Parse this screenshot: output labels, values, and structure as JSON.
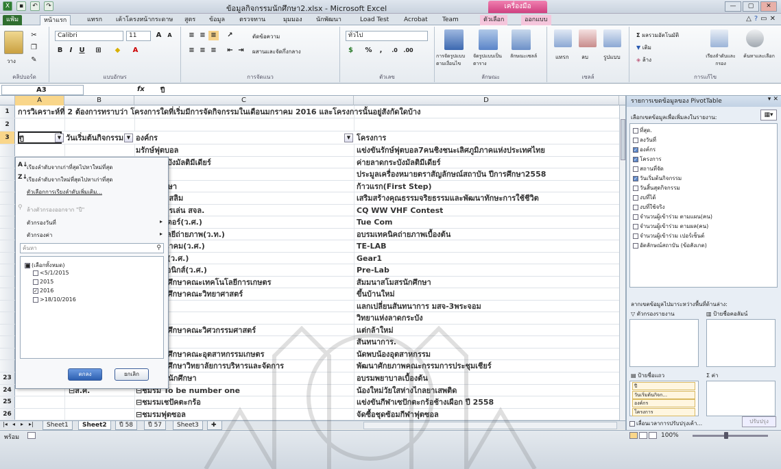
{
  "title": {
    "window": "ข้อมูลกิจกรรมนักศึกษา2.xlsx - Microsoft Excel",
    "context_tab": "เครื่องมือ PivotTable",
    "min": "—",
    "max": "▢",
    "close": "✕"
  },
  "tabs": [
    "แฟ้ม",
    "หน้าแรก",
    "แทรก",
    "เค้าโครงหน้ากระดาษ",
    "สูตร",
    "ข้อมูล",
    "ตรวจทาน",
    "มุมมอง",
    "นักพัฒนา",
    "Load Test",
    "Acrobat",
    "Team",
    "ตัวเลือก",
    "ออกแบบ"
  ],
  "ribbon": {
    "clipboard": {
      "paste": "วาง",
      "label": "คลิปบอร์ด"
    },
    "font": {
      "name": "Calibri",
      "size": "11",
      "label": "แบบอักษร"
    },
    "alignment": {
      "wrap": "ตัดข้อความ",
      "merge": "ผสานและจัดกึ่งกลาง",
      "label": "การจัดแนว"
    },
    "number": {
      "format": "ทั่วไป",
      "pct": "%",
      "comma": ",",
      "label": "ตัวเลข"
    },
    "styles": {
      "cond": "การจัดรูปแบบตามเงื่อนไข",
      "table": "จัดรูปแบบเป็นตาราง",
      "cell": "ลักษณะเซลล์",
      "label": "ลักษณะ"
    },
    "cells": {
      "insert": "แทรก",
      "delete": "ลบ",
      "format": "รูปแบบ",
      "label": "เซลล์"
    },
    "editing": {
      "sum": "ผลรวมอัตโนมัติ",
      "fill": "เติม",
      "clear": "ล้าง",
      "sort": "เรียงลำดับและกรอง",
      "find": "ค้นหาและเลือก",
      "label": "การแก้ไข"
    }
  },
  "formula": {
    "namebox": "A3",
    "fx": "fx",
    "content": "ปี"
  },
  "columns": [
    "A",
    "B",
    "C",
    "D"
  ],
  "rows": [
    {
      "n": "1",
      "a": "การวิเคราะห์ที่ 2 ต้องการทราบว่า  โครงการใดที่เริ่มมีการจัดกิจกรรมในเดือนมกราคม  2016 และโครงการนั้นอยู่สังกัดใดบ้าง",
      "c": "",
      "d": ""
    },
    {
      "n": "2",
      "a": "",
      "c": "",
      "d": ""
    },
    {
      "n": "3",
      "a": "ปี",
      "b": "วันเริ่มต้นกิจกรรม",
      "c": "องค์กร",
      "d": "โครงการ"
    }
  ],
  "body_rows": [
    {
      "c": "มรักษ์ฟุตบอล",
      "d": "แข่งขันรักษ์ฟุตบอล7คนชิงชนะเลิศภูมิภาคแห่งประเทศไทย"
    },
    {
      "c": "มลาดกระบังมัลติมีเดียร์",
      "d": "ค่ายลาดกระบังมัลติมีเดียร์"
    },
    {
      "c": "นักศึกษา",
      "d": "ประมูลเครื่องหมายตราสัญลักษณ์สถาบัน  ปีการศึกษา2558"
    },
    {
      "c": "การนักศึกษา",
      "d": "ก้าวแรก(First Step)"
    },
    {
      "c": "นักศึกษามุสลิม",
      "d": "เสริมสร้างคุณธรรมจริยธรรมและพัฒนาทักษะการใช้ชีวิต"
    },
    {
      "c": "มวิทยุสมัครเล่น  สจล.",
      "d": "CQ WW VHF Contest"
    },
    {
      "c": "มคอมพิวเตอร์(ว.ศ.)",
      "d": "Tue Com"
    },
    {
      "c": "มเทคโนโลยีถ่ายภาพ(ว.ท.)",
      "d": "อบรมเทคนิคถ่ายภาพเบื้องต้น"
    },
    {
      "c": "มโทรคมนาคม(ว.ศ.)",
      "d": "TE-LAB"
    },
    {
      "c": "มวิชาการ(ว.ศ.)",
      "d": "Gear1"
    },
    {
      "c": "มอิเลคทรอนิกส์(ว.ศ.)",
      "d": "Pre-Lab"
    },
    {
      "c": "สโมสรนักศึกษาคณะเทคโนโลยีการเกษตร",
      "d": "สัมมนาสโมสรนักศึกษา"
    },
    {
      "c": "สโมสรนักศึกษาคณะวิทยาศาสตร์",
      "d": "ขึ้นบ้านใหม่"
    },
    {
      "c": "",
      "d": "แลกเปลี่ยนสันทนาการ  มสจ-3พระจอม"
    },
    {
      "c": "",
      "d": "วิทยาแห่งลาดกระบัง"
    },
    {
      "c": "สโมสรนักศึกษาคณะวิศวกรรมศาสตร์",
      "d": "แต่กล้าใหม่"
    },
    {
      "c": "",
      "d": "สันทนาการ."
    },
    {
      "c": "สโมสรนักศึกษาคณะอุตสาหกรรมเกษตร",
      "d": "นัดพบน้องอุตสาหกรรม"
    },
    {
      "c": "สโมสรนักศึกษาวิทยาลัยการบริหารและจัดการ",
      "d": "พัฒนาศักยภาพคณะกรรมการประชุมเชียร์"
    }
  ],
  "tail_rows": [
    {
      "n": "23",
      "b": "",
      "c": "⊟องค์การนักศึกษา",
      "d": "อบรมพยาบาลเบื้องต้น"
    },
    {
      "n": "24",
      "b": "⊟ส.ศ.",
      "c": "⊟ชมรม  To be number one",
      "d": "น้องใหม่วัยใสห่างไกลยาเสพติด"
    },
    {
      "n": "25",
      "b": "",
      "c": "⊟ชมรมเชปัคตะกร้อ",
      "d": "แข่งขันกีฬาเซปักตะกร้อช้างเผือก  ปี  2558"
    },
    {
      "n": "26",
      "b": "",
      "c": "⊟ชมรมฟุตซอล",
      "d": "จัดซื้อชุดซ้อมกีฬาฟุตซอล"
    }
  ],
  "filter_menu": {
    "sort_asc": "เรียงลำดับจากเก่าที่สุดไปหาใหม่ที่สุด",
    "sort_desc": "เรียงลำดับจากใหม่ที่สุดไปหาเก่าที่สุด",
    "more_sort": "ตัวเลือกการเรียงลำดับเพิ่มเติม...",
    "clear": "ล้างตัวกรองออกจาก \"ปี\"",
    "date_filter": "ตัวกรองวันที่",
    "value_filter": "ตัวกรองค่า",
    "search_placeholder": "ค้นหา",
    "items": [
      {
        "label": "(เลือกทั้งหมด)",
        "state": "partial"
      },
      {
        "label": "<5/1/2015",
        "state": "off"
      },
      {
        "label": "2015",
        "state": "off"
      },
      {
        "label": "2016",
        "state": "on"
      },
      {
        "label": ">18/10/2016",
        "state": "off"
      }
    ],
    "ok": "ตกลง",
    "cancel": "ยกเลิก"
  },
  "sheets": [
    "Sheet1",
    "Sheet2",
    "ปี 58",
    "ปี 57",
    "Sheet3"
  ],
  "active_sheet": "Sheet2",
  "status": {
    "ready": "พร้อม",
    "zoom": "100%"
  },
  "pivot": {
    "title": "รายการเขตข้อมูลของ PivotTable",
    "close": "▾ ✕",
    "choose": "เลือกเขตข้อมูลเพื่อเพิ่มลงในรายงาน:",
    "fields": [
      {
        "label": "ที่สุด.",
        "checked": false
      },
      {
        "label": "ลงวันที่",
        "checked": false
      },
      {
        "label": "องค์กร",
        "checked": true
      },
      {
        "label": "โครงการ",
        "checked": true
      },
      {
        "label": "สถานที่จัด",
        "checked": false
      },
      {
        "label": "วันเริ่มต้นกิจกรรม",
        "checked": true
      },
      {
        "label": "วันสิ้นสุดกิจกรรม",
        "checked": false
      },
      {
        "label": "งบที่ได้",
        "checked": false
      },
      {
        "label": "งบที่ใช้จริง",
        "checked": false
      },
      {
        "label": "จำนวนผู้เข้าร่วม ตามแผน(คน)",
        "checked": false
      },
      {
        "label": "จำนวนผู้เข้าร่วม ตามผล(คน)",
        "checked": false
      },
      {
        "label": "จำนวนผู้เข้าร่วม เปอร์เซ็นต์",
        "checked": false
      },
      {
        "label": "อัตลักษณ์สถาบัน (ข้อสังเกต)",
        "checked": false
      }
    ],
    "drag": "ลากเขตข้อมูลไปมาระหว่างพื้นที่ด้านล่าง:",
    "report_filter": "ตัวกรองรายงาน",
    "col_labels": "ป้ายชื่อคอลัมน์",
    "row_labels": "ป้ายชื่อแถว",
    "values": "ค่า",
    "row_items": [
      "ปี",
      "วันเริ่มต้นกิจก...",
      "องค์กร",
      "โครงการ"
    ],
    "defer": "เลื่อนเวลาการปรับปรุงเค้า...",
    "update": "ปรับปรุง"
  }
}
